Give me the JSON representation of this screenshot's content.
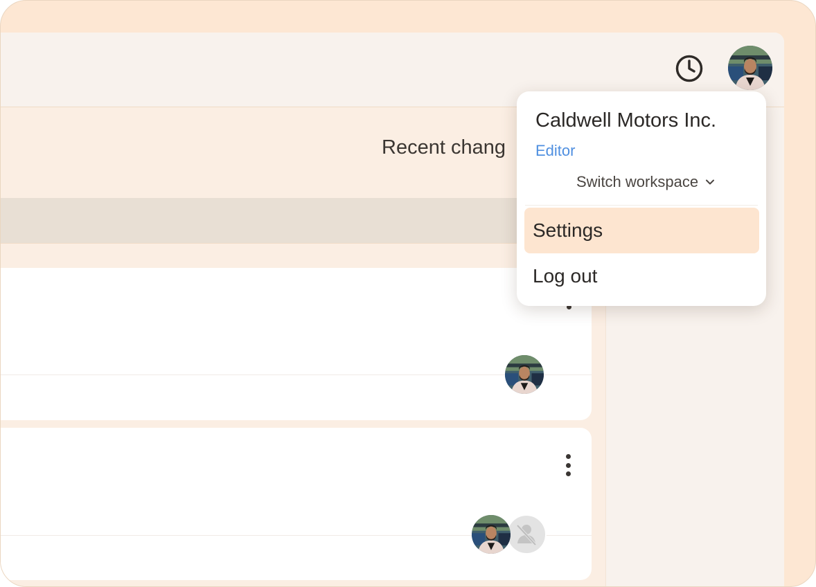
{
  "header": {
    "history_icon": "clock-icon",
    "avatar": "user-avatar"
  },
  "main": {
    "section_title": "Recent chang",
    "cards": [
      {
        "menu_icon": "kebab-menu-icon",
        "collaborators": [
          "user-avatar"
        ]
      },
      {
        "menu_icon": "kebab-menu-icon",
        "collaborators": [
          "user-avatar",
          "unknown-user-avatar"
        ]
      }
    ]
  },
  "dropdown": {
    "workspace_name": "Caldwell Motors Inc.",
    "role": "Editor",
    "switch_label": "Switch workspace",
    "items": [
      {
        "label": "Settings",
        "highlighted": true
      },
      {
        "label": "Log out",
        "highlighted": false
      }
    ]
  },
  "colors": {
    "frame": "#fde7d3",
    "app_bg": "#f8f2ed",
    "highlight": "#fde5d0",
    "role_blue": "#4f8fe0"
  }
}
